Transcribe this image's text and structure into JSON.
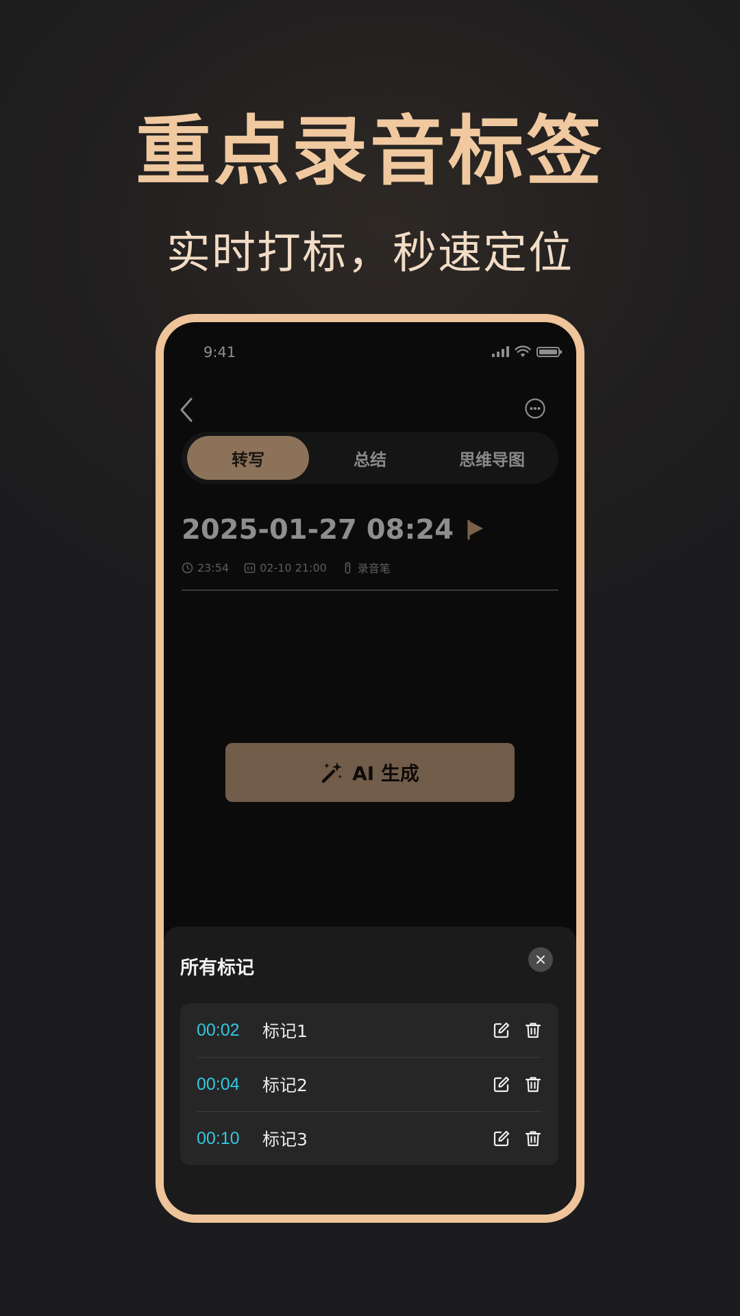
{
  "headline": "重点录音标签",
  "subheadline": "实时打标，秒速定位",
  "phone": {
    "status_bar": {
      "time": "9:41"
    },
    "tabs": [
      {
        "label": "转写",
        "active": true
      },
      {
        "label": "总结",
        "active": false
      },
      {
        "label": "思维导图",
        "active": false
      }
    ],
    "recording": {
      "title": "2025-01-27 08:24",
      "duration": "23:54",
      "date": "02-10 21:00",
      "device": "录音笔"
    },
    "ai_button_label": "AI 生成",
    "marks_sheet": {
      "title": "所有标记",
      "marks": [
        {
          "time": "00:02",
          "label": "标记1"
        },
        {
          "time": "00:04",
          "label": "标记2"
        },
        {
          "time": "00:10",
          "label": "标记3"
        }
      ]
    }
  },
  "colors": {
    "accent": "#efc49a",
    "tab_active": "#8b7259",
    "ai_button": "#725d4a",
    "mark_time": "#33c8e0"
  },
  "icons": [
    "back-icon",
    "more-icon",
    "flag-icon",
    "clock-icon",
    "calendar-icon",
    "recorder-icon",
    "magic-wand-icon",
    "close-icon",
    "edit-icon",
    "trash-icon",
    "signal-icon",
    "wifi-icon",
    "battery-icon"
  ]
}
